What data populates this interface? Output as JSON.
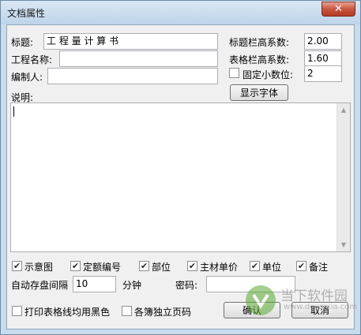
{
  "window": {
    "title": "文档属性",
    "close_glyph": "✕"
  },
  "fields": {
    "title_label": "标题:",
    "title_value": "工 程 量 计 算 书",
    "project_label": "工程名称:",
    "project_value": "",
    "author_label": "编制人:",
    "author_value": "",
    "header_ratio_label": "标题栏高系数:",
    "header_ratio_value": "2.00",
    "table_ratio_label": "表格栏高系数:",
    "table_ratio_value": "1.60",
    "fixed_decimal_label": "固定小数位:",
    "fixed_decimal_value": "2",
    "show_font_button": "显示字体",
    "notes_label": "说明:"
  },
  "options": {
    "items": [
      {
        "label": "示意图",
        "checked": true
      },
      {
        "label": "定额编号",
        "checked": true
      },
      {
        "label": "部位",
        "checked": true
      },
      {
        "label": "主材单价",
        "checked": true
      },
      {
        "label": "单位",
        "checked": true
      },
      {
        "label": "备注",
        "checked": true
      }
    ],
    "autosave_label": "自动存盘间隔",
    "autosave_value": "10",
    "autosave_unit": "分钟",
    "password_label": "密码:",
    "password_value": "",
    "print_black_label": "打印表格线均用黑色",
    "print_black_checked": false,
    "independent_page_label": "各簿独立页码",
    "independent_page_checked": false
  },
  "buttons": {
    "ok": "确认",
    "cancel": "取消"
  },
  "watermark": {
    "text": "当下软件园",
    "url": "www.downxia.com"
  },
  "colors": {
    "frame": "#c9dced",
    "close": "#c8553f",
    "logo_green": "#5aa832"
  }
}
